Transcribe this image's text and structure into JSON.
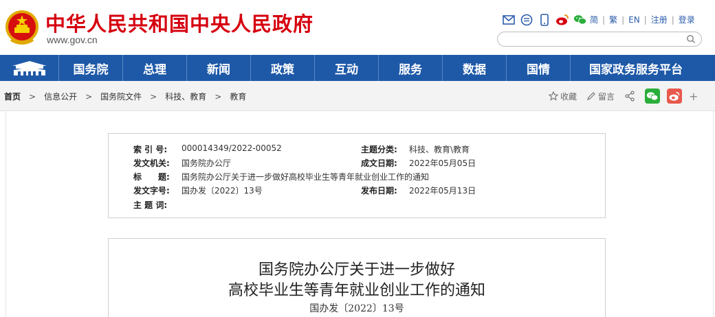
{
  "header": {
    "site_title": "中华人民共和国中央人民政府",
    "site_url": "www.gov.cn",
    "icons": [
      "mail-icon",
      "chat-icon",
      "mobile-icon",
      "weibo-icon",
      "wechat-icon"
    ],
    "lang_links": [
      "简",
      "繁",
      "EN",
      "注册",
      "登录"
    ],
    "search_placeholder": "",
    "accent_color": "#d6000f"
  },
  "nav": {
    "items": [
      "国务院",
      "总理",
      "新闻",
      "政策",
      "互动",
      "服务",
      "数据",
      "国情",
      "国家政务服务平台"
    ],
    "bg_color": "#1e59a8"
  },
  "breadcrumb": {
    "items": [
      "首页",
      "信息公开",
      "国务院文件",
      "科技、教育",
      "教育"
    ],
    "tools": {
      "favorite": "收藏",
      "comment": "留言"
    }
  },
  "meta": {
    "index_label": "索 引 号:",
    "index_value": "000014349/2022-00052",
    "topic_label": "主题分类:",
    "topic_value": "科技、教育\\教育",
    "issuer_label": "发文机关:",
    "issuer_value": "国务院办公厅",
    "written_label": "成文日期:",
    "written_value": "2022年05月05日",
    "title_label": "标　　题:",
    "title_value": "国务院办公厅关于进一步做好高校毕业生等青年就业创业工作的通知",
    "docno_label": "发文字号:",
    "docno_value": "国办发〔2022〕13号",
    "published_label": "发布日期:",
    "published_value": "2022年05月13日",
    "keywords_label": "主 题 词:",
    "keywords_value": ""
  },
  "document": {
    "title_line1": "国务院办公厅关于进一步做好",
    "title_line2": "高校毕业生等青年就业创业工作的通知",
    "doc_number": "国办发〔2022〕13号"
  }
}
